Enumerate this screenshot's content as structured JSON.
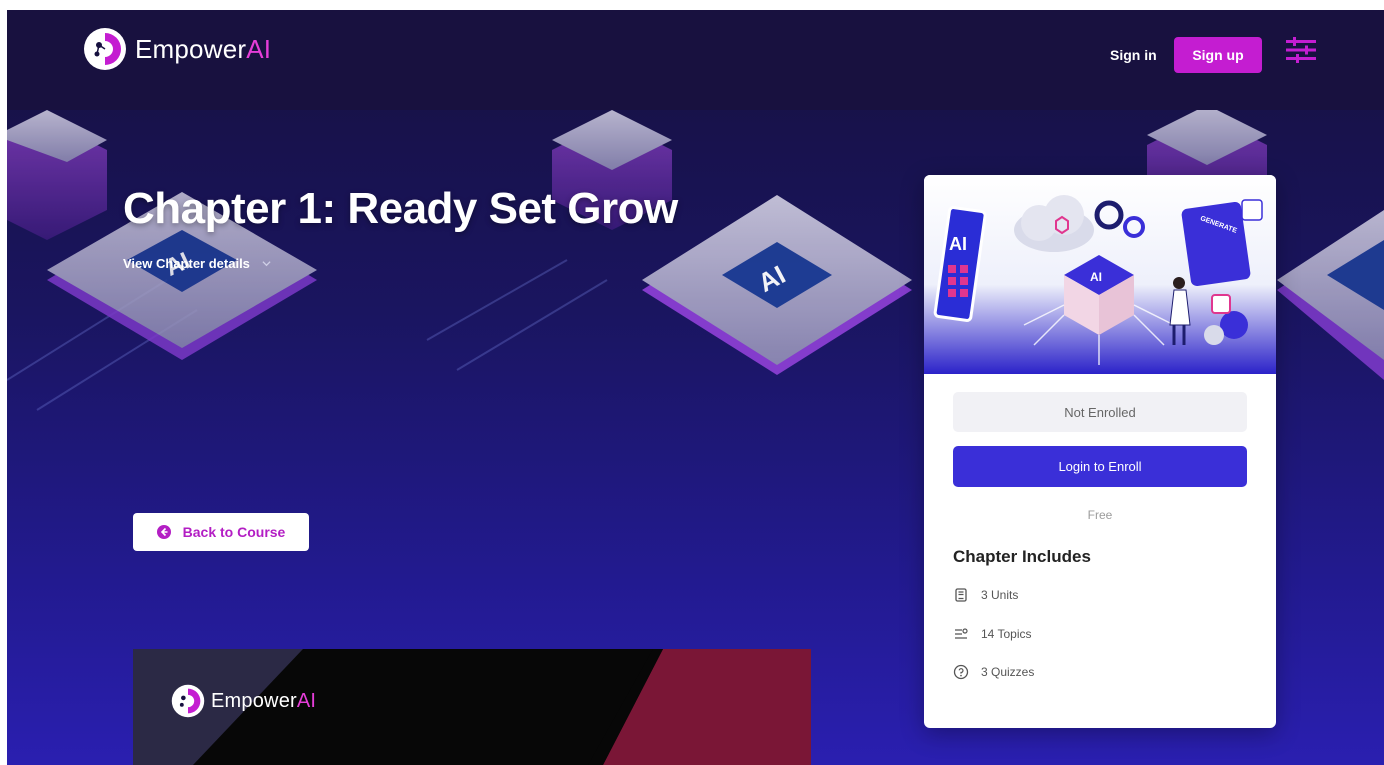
{
  "brand": {
    "name_part1": "Empower",
    "name_part2": "AI",
    "accent": "#e53dd8"
  },
  "header": {
    "sign_in": "Sign in",
    "sign_up": "Sign up",
    "menu_icon": "settings-sliders-icon",
    "signup_color": "#c41dd1"
  },
  "hero": {
    "title": "Chapter 1: Ready Set Grow",
    "details_toggle": "View Chapter details",
    "back_button": "Back to Course",
    "chip_label": "AI"
  },
  "preview": {
    "brand_part1": "Empower",
    "brand_part2": "AI"
  },
  "card": {
    "image_chip_labels": [
      "AI",
      "AI",
      "GENERATE"
    ],
    "status": "Not Enrolled",
    "enroll_button": "Login to Enroll",
    "price": "Free",
    "includes_title": "Chapter Includes",
    "items": [
      {
        "icon": "book-icon",
        "label": "3 Units"
      },
      {
        "icon": "list-icon",
        "label": "14 Topics"
      },
      {
        "icon": "question-circle-icon",
        "label": "3 Quizzes"
      }
    ],
    "primary_color": "#3a2fd8"
  }
}
